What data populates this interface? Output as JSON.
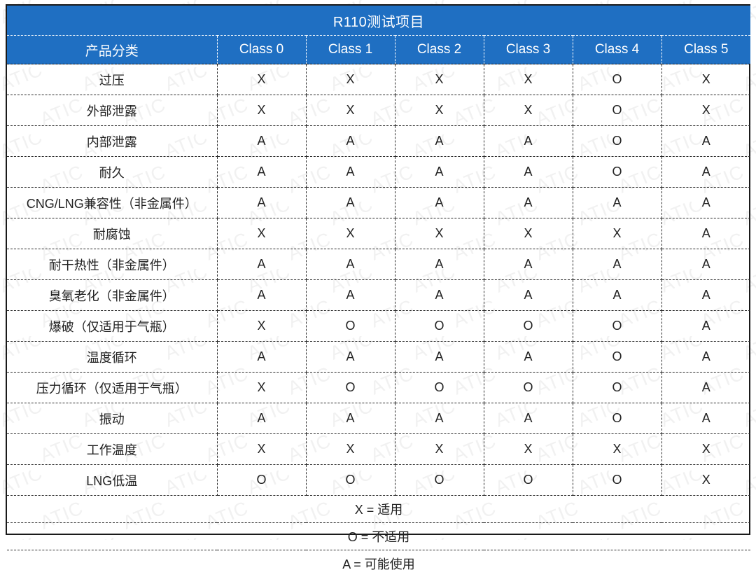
{
  "table": {
    "title": "R110测试项目",
    "columns": [
      {
        "label": "产品分类",
        "key": "category"
      },
      {
        "label": "Class 0",
        "key": "class0"
      },
      {
        "label": "Class 1",
        "key": "class1"
      },
      {
        "label": "Class 2",
        "key": "class2"
      },
      {
        "label": "Class 3",
        "key": "class3"
      },
      {
        "label": "Class 4",
        "key": "class4"
      },
      {
        "label": "Class 5",
        "key": "class5"
      }
    ],
    "rows": [
      {
        "category": "过压",
        "values": [
          "X",
          "X",
          "X",
          "X",
          "O",
          "X"
        ]
      },
      {
        "category": "外部泄露",
        "values": [
          "X",
          "X",
          "X",
          "X",
          "O",
          "X"
        ]
      },
      {
        "category": "内部泄露",
        "values": [
          "A",
          "A",
          "A",
          "A",
          "O",
          "A"
        ]
      },
      {
        "category": "耐久",
        "values": [
          "A",
          "A",
          "A",
          "A",
          "O",
          "A"
        ]
      },
      {
        "category": "CNG/LNG兼容性（非金属件）",
        "values": [
          "A",
          "A",
          "A",
          "A",
          "A",
          "A"
        ]
      },
      {
        "category": "耐腐蚀",
        "values": [
          "X",
          "X",
          "X",
          "X",
          "X",
          "A"
        ]
      },
      {
        "category": "耐干热性（非金属件）",
        "values": [
          "A",
          "A",
          "A",
          "A",
          "A",
          "A"
        ]
      },
      {
        "category": "臭氧老化（非金属件）",
        "values": [
          "A",
          "A",
          "A",
          "A",
          "A",
          "A"
        ]
      },
      {
        "category": "爆破（仅适用于气瓶）",
        "values": [
          "X",
          "O",
          "O",
          "O",
          "O",
          "A"
        ]
      },
      {
        "category": "温度循环",
        "values": [
          "A",
          "A",
          "A",
          "A",
          "O",
          "A"
        ]
      },
      {
        "category": "压力循环（仅适用于气瓶）",
        "values": [
          "X",
          "O",
          "O",
          "O",
          "O",
          "A"
        ]
      },
      {
        "category": "振动",
        "values": [
          "A",
          "A",
          "A",
          "A",
          "O",
          "A"
        ]
      },
      {
        "category": "工作温度",
        "values": [
          "X",
          "X",
          "X",
          "X",
          "X",
          "X"
        ]
      },
      {
        "category": "LNG低温",
        "values": [
          "O",
          "O",
          "O",
          "O",
          "O",
          "X"
        ]
      }
    ],
    "legend": [
      "X = 适用",
      "O = 不适用",
      "A = 可能使用"
    ],
    "watermark_text": "ATIC",
    "colors": {
      "header_blue": "#1f6fc2",
      "header_text": "#ffffff",
      "body_text": "#222222",
      "border": "#2b2b2b",
      "frame": "#1a1a1a",
      "watermark": "#f2f2f2"
    }
  }
}
